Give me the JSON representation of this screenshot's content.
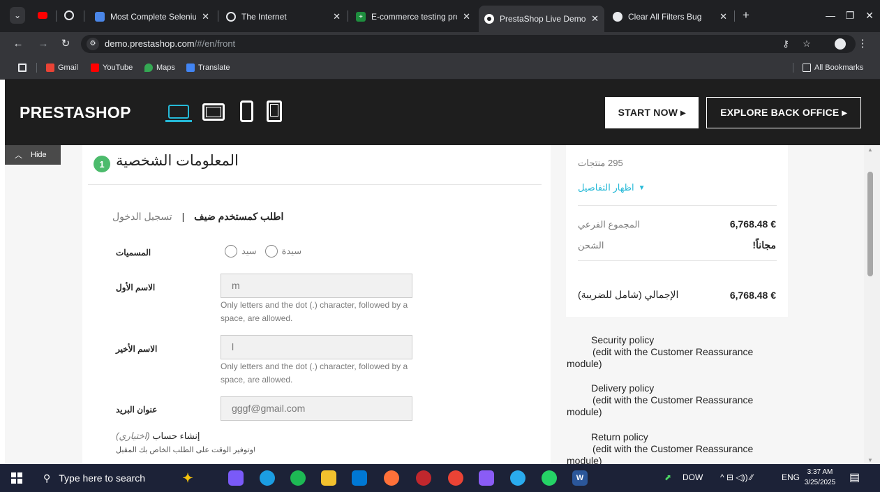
{
  "browser": {
    "tabs": [
      {
        "title": "Most Complete Seleniu",
        "icon": "doc-icon",
        "color": "#4a86e8",
        "active": false
      },
      {
        "title": "The Internet",
        "icon": "globe-icon",
        "color": "#9aa0a6",
        "active": false
      },
      {
        "title": "E-commerce testing proj",
        "icon": "sheets-icon",
        "color": "#1e8e3e",
        "active": false
      },
      {
        "title": "PrestaShop Live Demo",
        "icon": "prestashop-icon",
        "color": "#df0067",
        "active": true
      },
      {
        "title": "Clear All Filters Bug",
        "icon": "chatgpt-icon",
        "color": "#e8eaed",
        "active": false
      }
    ],
    "url_host": "demo.prestashop.com",
    "url_path": "/#/en/front",
    "bookmarks": [
      {
        "label": "Gmail",
        "icon": "gmail-icon",
        "color": "#ea4335"
      },
      {
        "label": "YouTube",
        "icon": "youtube-icon",
        "color": "#ff0000"
      },
      {
        "label": "Maps",
        "icon": "maps-icon",
        "color": "#34a853"
      },
      {
        "label": "Translate",
        "icon": "translate-icon",
        "color": "#4285f4"
      }
    ],
    "all_bookmarks": "All Bookmarks"
  },
  "demo_header": {
    "logo": "PRESTASHOP",
    "start_now": "START NOW ▸",
    "explore_back_office": "EXPLORE BACK OFFICE ▸",
    "accent": "#25b9d7"
  },
  "hide_button": "Hide",
  "checkout": {
    "step_number": "1",
    "step_title": "المعلومات الشخصية",
    "order_as_guest": "اطلب كمستخدم ضيف",
    "separator": "|",
    "sign_in": "تسجيل الدخول",
    "social_title_label": "المسميات",
    "title_mrs": "سيدة",
    "title_mr": "سيد",
    "first_name_label": "الاسم الأول",
    "first_name_value": "m",
    "name_help": "Only letters and the dot (.) character, followed by a space, are allowed.",
    "last_name_label": "الاسم الأخير",
    "last_name_value": "l",
    "email_label": "عنوان البريد",
    "email_value": "gggf@gmail.com",
    "create_account": "إنشاء حساب",
    "optional": "(اختياري)",
    "save_time": "!وتوفير الوقت على الطلب الخاص بك المقبل"
  },
  "summary": {
    "product_count": "295 منتجات",
    "show_details": "اظهار التفاصيل",
    "subtotal_label": "المجموع الفرعي",
    "subtotal_value": "6,768.48 €",
    "shipping_label": "الشحن",
    "shipping_value": "!مجاناً",
    "total_label": "الإجمالي (شامل للضريبة)",
    "total_value": "6,768.48 €"
  },
  "reassurance": [
    {
      "title": "Security policy",
      "sub": "(edit with the Customer Reassurance",
      "tail": "module)"
    },
    {
      "title": "Delivery policy",
      "sub": "(edit with the Customer Reassurance",
      "tail": "module)"
    },
    {
      "title": "Return policy",
      "sub": "(edit with the Customer Reassurance",
      "tail": "module)"
    }
  ],
  "taskbar": {
    "search_placeholder": "Type here to search",
    "stock_label": "DOW",
    "language": "ENG",
    "time": "3:37 AM",
    "date": "3/25/2025"
  }
}
